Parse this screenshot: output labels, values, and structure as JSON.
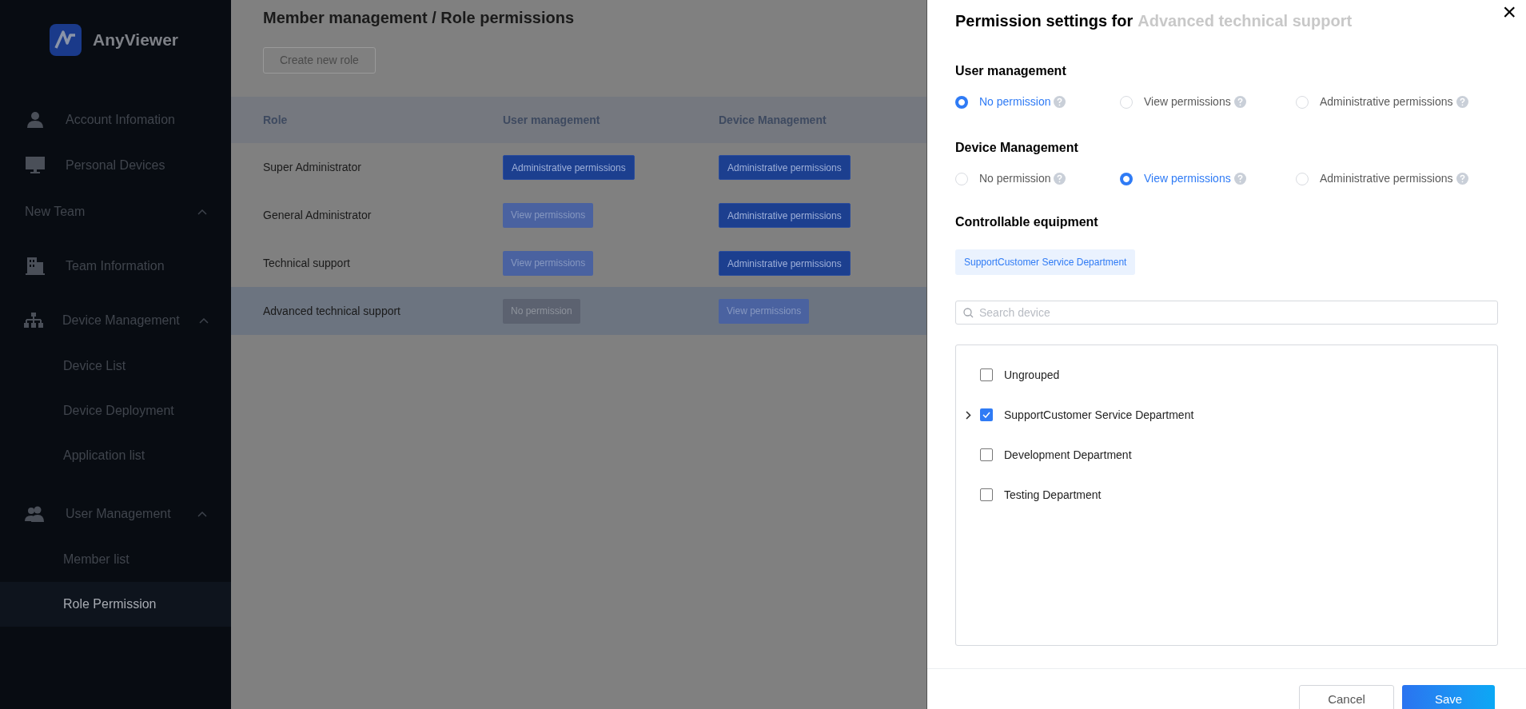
{
  "sidebar": {
    "logo_text": "AnyViewer",
    "items": [
      {
        "kind": "link",
        "label": "Account Infomation"
      },
      {
        "kind": "link",
        "label": "Personal Devices"
      },
      {
        "kind": "section",
        "label": "New Team",
        "expanded": true,
        "children": [
          {
            "kind": "link",
            "label": "Team Information"
          },
          {
            "kind": "group",
            "label": "Device Management",
            "expanded": true,
            "children": [
              {
                "label": "Device List",
                "selected": false
              },
              {
                "label": "Device Deployment",
                "selected": false
              },
              {
                "label": "Application list",
                "selected": false
              }
            ]
          },
          {
            "kind": "group",
            "label": "User Management",
            "expanded": true,
            "children": [
              {
                "label": "Member list",
                "selected": false
              },
              {
                "label": "Role Permission",
                "selected": true
              }
            ]
          }
        ]
      }
    ]
  },
  "main": {
    "title": "Member management / Role permissions",
    "create_button": "Create new role",
    "table": {
      "columns": [
        "Role",
        "User management",
        "Device Management"
      ],
      "rows": [
        {
          "role": "Super Administrator",
          "selected": false,
          "user_management": {
            "kind": "admin",
            "label": "Administrative permissions"
          },
          "device_management": {
            "kind": "admin",
            "label": "Administrative permissions"
          }
        },
        {
          "role": "General Administrator",
          "selected": false,
          "user_management": {
            "kind": "view",
            "label": "View permissions"
          },
          "device_management": {
            "kind": "admin",
            "label": "Administrative permissions"
          }
        },
        {
          "role": "Technical support",
          "selected": false,
          "user_management": {
            "kind": "view",
            "label": "View permissions"
          },
          "device_management": {
            "kind": "admin",
            "label": "Administrative permissions"
          }
        },
        {
          "role": "Advanced technical support",
          "selected": true,
          "user_management": {
            "kind": "none",
            "label": "No permission"
          },
          "device_management": {
            "kind": "view",
            "label": "View permissions"
          }
        }
      ]
    }
  },
  "drawer": {
    "title": "Permission settings for",
    "title_role": "Advanced technical support",
    "close": "×",
    "sections": [
      {
        "heading": "User management",
        "options": [
          {
            "label": "No permission",
            "selected": true
          },
          {
            "label": "View permissions",
            "selected": false
          },
          {
            "label": "Administrative permissions",
            "selected": false
          }
        ]
      },
      {
        "heading": "Device Management",
        "options": [
          {
            "label": "No permission",
            "selected": false
          },
          {
            "label": "View permissions",
            "selected": true
          },
          {
            "label": "Administrative permissions",
            "selected": false
          }
        ]
      }
    ],
    "equipment_heading": "Controllable equipment",
    "tags": [
      "SupportCustomer Service Department"
    ],
    "search": {
      "placeholder": "Search device"
    },
    "tree": [
      {
        "label": "Ungrouped",
        "checked": false,
        "expandable": false
      },
      {
        "label": "SupportCustomer Service Department",
        "checked": true,
        "expandable": true
      },
      {
        "label": "Development Department",
        "checked": false,
        "expandable": false
      },
      {
        "label": "Testing Department",
        "checked": false,
        "expandable": false
      }
    ],
    "buttons": {
      "cancel": "Cancel",
      "save": "Save"
    }
  }
}
